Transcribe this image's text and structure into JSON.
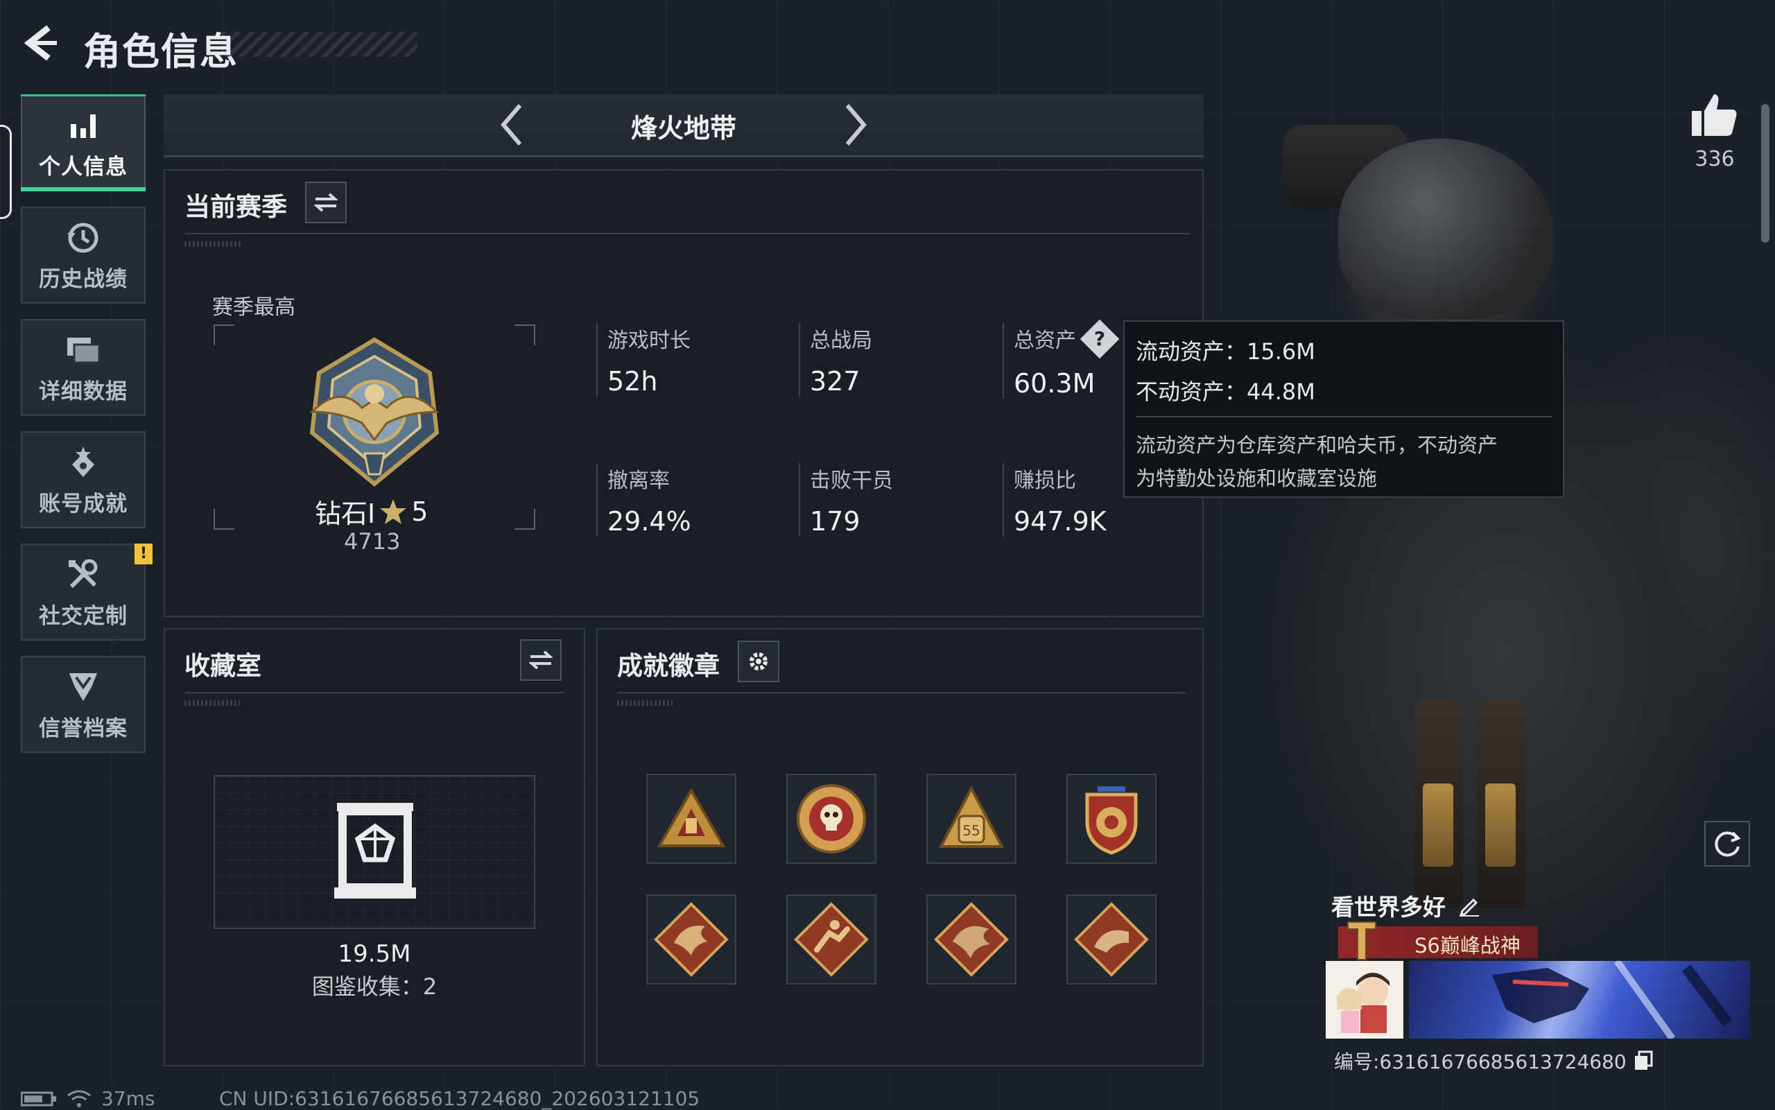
{
  "header": {
    "title": "角色信息"
  },
  "nav": [
    {
      "label": "个人信息",
      "icon": "bar-chart-icon",
      "active": true
    },
    {
      "label": "历史战绩",
      "icon": "history-icon"
    },
    {
      "label": "详细数据",
      "icon": "folder-icon"
    },
    {
      "label": "账号成就",
      "icon": "achievement-icon"
    },
    {
      "label": "社交定制",
      "icon": "tools-icon",
      "alert": "!"
    },
    {
      "label": "信誉档案",
      "icon": "credit-icon"
    }
  ],
  "mode": {
    "title": "烽火地带"
  },
  "season": {
    "title": "当前赛季",
    "best_label": "赛季最高",
    "rank_name": "钻石I",
    "rank_stars": "5",
    "rank_score": "4713",
    "stats": [
      {
        "label": "游戏时长",
        "value": "52h"
      },
      {
        "label": "总战局",
        "value": "327"
      },
      {
        "label": "总资产",
        "value": "60.3M",
        "help": true
      },
      {
        "label": "撤离率",
        "value": "29.4%"
      },
      {
        "label": "击败干员",
        "value": "179"
      },
      {
        "label": "赚损比",
        "value": "947.9K"
      }
    ]
  },
  "tooltip": {
    "liquid": "流动资产：15.6M",
    "fixed": "不动资产：44.8M",
    "desc_line1": "流动资产为仓库资产和哈夫币，不动资产",
    "desc_line2": "为特勤处设施和收藏室设施"
  },
  "collection": {
    "title": "收藏室",
    "value": "19.5M",
    "count": "图鉴收集：2"
  },
  "badges": {
    "title": "成就徽章",
    "items": [
      "triangle-badge-icon",
      "skull-medal-icon",
      "backpack-badge-icon",
      "shield-stars-icon",
      "dragon-diamond-icon",
      "runner-diamond-icon",
      "dragon-diamond-icon-2",
      "croc-diamond-icon"
    ]
  },
  "profile": {
    "likes": "336",
    "name": "看世界多好",
    "title": "S6巅峰战神",
    "uid": "编号:631616766856137246​80"
  },
  "footer": {
    "ping": "37ms",
    "uid": "CN UID:631616766856137246​80_202603121105"
  },
  "colors": {
    "accent": "#43d39a",
    "alert": "#f0c33b",
    "ribbon": "#a02828"
  }
}
